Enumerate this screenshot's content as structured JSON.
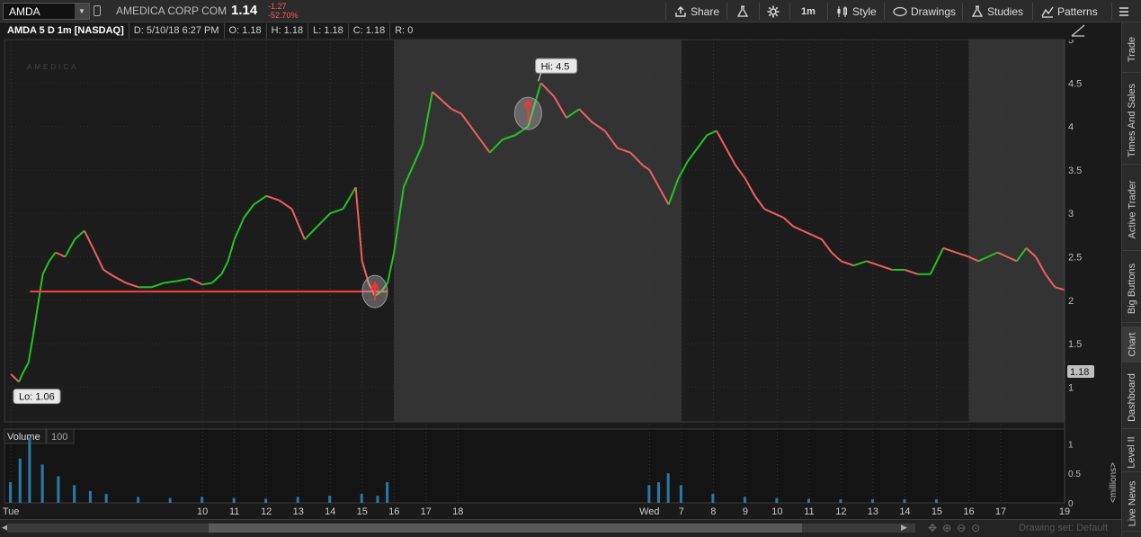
{
  "toolbar": {
    "symbol": "AMDA",
    "company": "AMEDICA CORP COM",
    "last": "1.14",
    "change": "-1.27",
    "change_pct": "-52.70%",
    "share": "Share",
    "interval": "1m",
    "style": "Style",
    "drawings": "Drawings",
    "studies": "Studies",
    "patterns": "Patterns"
  },
  "header": {
    "symbol_desc": "AMDA 5 D 1m [NASDAQ]",
    "date": "D: 5/10/18 6:27 PM",
    "open": "O: 1.18",
    "high": "H: 1.18",
    "low": "L: 1.18",
    "close": "C: 1.18",
    "range": "R: 0"
  },
  "watermark": "AMEDICA",
  "volume_label": "Volume",
  "volume_value": "100",
  "volume_unit": "<millions>",
  "hi_label": "Hi: 4.5",
  "lo_label": "Lo: 1.06",
  "last_price_tag": "1.18",
  "drawing_set": "Drawing set: Default",
  "right_tabs": [
    "Trade",
    "Times And Sales",
    "Active Trader",
    "Big Buttons",
    "Chart",
    "Dashboard",
    "Level II",
    "Live News"
  ],
  "chart_data": {
    "type": "line",
    "title": "AMDA 5 D 1m [NASDAQ]",
    "y_axis_ticks": [
      "5",
      "4.5",
      "4",
      "3.5",
      "3",
      "2.5",
      "2",
      "1.5",
      "1"
    ],
    "ylim": [
      0.6,
      5.0
    ],
    "volume_ticks": [
      "1",
      "0.5",
      "0"
    ],
    "x_tick_labels": [
      "Tue",
      "10",
      "11",
      "12",
      "13",
      "14",
      "15",
      "16",
      "17",
      "18",
      "Wed",
      "7",
      "8",
      "9",
      "10",
      "11",
      "12",
      "13",
      "14",
      "15",
      "16",
      "17",
      "19"
    ],
    "x_tick_times": [
      4,
      10,
      11,
      12,
      13,
      14,
      15,
      16,
      17,
      18,
      24,
      25,
      26,
      27,
      28,
      29,
      30,
      31,
      32,
      33,
      34,
      35,
      37
    ],
    "xlim": [
      3.8,
      37
    ],
    "extended_hours_regions": [
      [
        16,
        25
      ],
      [
        34,
        37
      ]
    ],
    "series": [
      {
        "x": [
          4.0,
          4.25,
          4.4,
          4.55,
          4.7,
          4.85,
          5.0,
          5.2,
          5.4,
          5.7,
          6.0,
          6.3,
          6.6,
          6.9,
          7.2,
          7.6,
          8.0,
          8.4,
          8.8,
          9.2,
          9.6,
          10.0,
          10.3,
          10.6,
          10.8,
          11.0,
          11.3,
          11.6,
          12.0,
          12.4,
          12.8,
          13.2,
          13.6,
          14.0,
          14.4,
          14.8,
          15.0,
          15.2,
          15.4,
          15.6,
          15.8,
          16.0,
          16.3,
          16.6,
          16.9,
          17.2,
          17.5,
          17.8,
          18.1,
          18.4,
          18.7,
          19.0,
          19.4,
          19.8,
          20.2,
          20.6,
          21.0,
          21.4,
          21.8,
          22.2,
          22.6,
          23.0,
          23.4,
          23.8,
          24.0,
          24.3,
          24.6,
          24.9,
          25.2,
          25.5,
          25.8,
          26.1,
          26.4,
          26.7,
          27.0,
          27.3,
          27.6,
          27.9,
          28.2,
          28.5,
          28.8,
          29.1,
          29.4,
          29.7,
          30.0,
          30.4,
          30.8,
          31.2,
          31.6,
          32.0,
          32.4,
          32.8,
          33.2,
          33.6,
          34.0,
          34.3,
          34.6,
          34.9,
          35.2,
          35.5,
          35.8,
          36.1,
          36.4,
          36.7,
          37.0
        ],
        "values": [
          1.15,
          1.06,
          1.18,
          1.28,
          1.6,
          1.95,
          2.3,
          2.45,
          2.55,
          2.5,
          2.7,
          2.8,
          2.58,
          2.35,
          2.28,
          2.2,
          2.15,
          2.15,
          2.2,
          2.22,
          2.25,
          2.18,
          2.2,
          2.3,
          2.45,
          2.7,
          2.95,
          3.1,
          3.2,
          3.15,
          3.05,
          2.7,
          2.85,
          3.0,
          3.05,
          3.3,
          2.45,
          2.2,
          2.05,
          2.1,
          2.2,
          2.55,
          3.3,
          3.55,
          3.8,
          4.4,
          4.3,
          4.2,
          4.15,
          4.0,
          3.85,
          3.7,
          3.85,
          3.9,
          4.0,
          4.5,
          4.35,
          4.1,
          4.2,
          4.05,
          3.95,
          3.75,
          3.7,
          3.55,
          3.5,
          3.3,
          3.1,
          3.4,
          3.6,
          3.75,
          3.9,
          3.95,
          3.75,
          3.55,
          3.4,
          3.2,
          3.05,
          3.0,
          2.95,
          2.85,
          2.8,
          2.75,
          2.7,
          2.55,
          2.45,
          2.4,
          2.45,
          2.4,
          2.35,
          2.35,
          2.3,
          2.3,
          2.6,
          2.55,
          2.5,
          2.45,
          2.5,
          2.55,
          2.5,
          2.45,
          2.6,
          2.5,
          2.3,
          2.15,
          2.12
        ]
      }
    ],
    "support_line": {
      "x0": 4.6,
      "x1": 15.8,
      "value": 2.1
    },
    "volume_series": {
      "x": [
        4.0,
        4.3,
        4.6,
        5.0,
        5.5,
        6.0,
        6.5,
        7.0,
        8.0,
        9.0,
        10.0,
        11.0,
        12.0,
        13.0,
        14.0,
        15.0,
        15.5,
        15.8,
        24.0,
        24.3,
        24.6,
        25.0,
        26.0,
        27.0,
        28.0,
        29.0,
        30.0,
        31.0,
        32.0,
        33.0
      ],
      "values": [
        0.35,
        0.75,
        1.1,
        0.65,
        0.45,
        0.3,
        0.2,
        0.15,
        0.1,
        0.08,
        0.1,
        0.08,
        0.07,
        0.1,
        0.12,
        0.15,
        0.12,
        0.35,
        0.3,
        0.35,
        0.5,
        0.3,
        0.15,
        0.1,
        0.08,
        0.07,
        0.06,
        0.06,
        0.06,
        0.06
      ]
    }
  }
}
